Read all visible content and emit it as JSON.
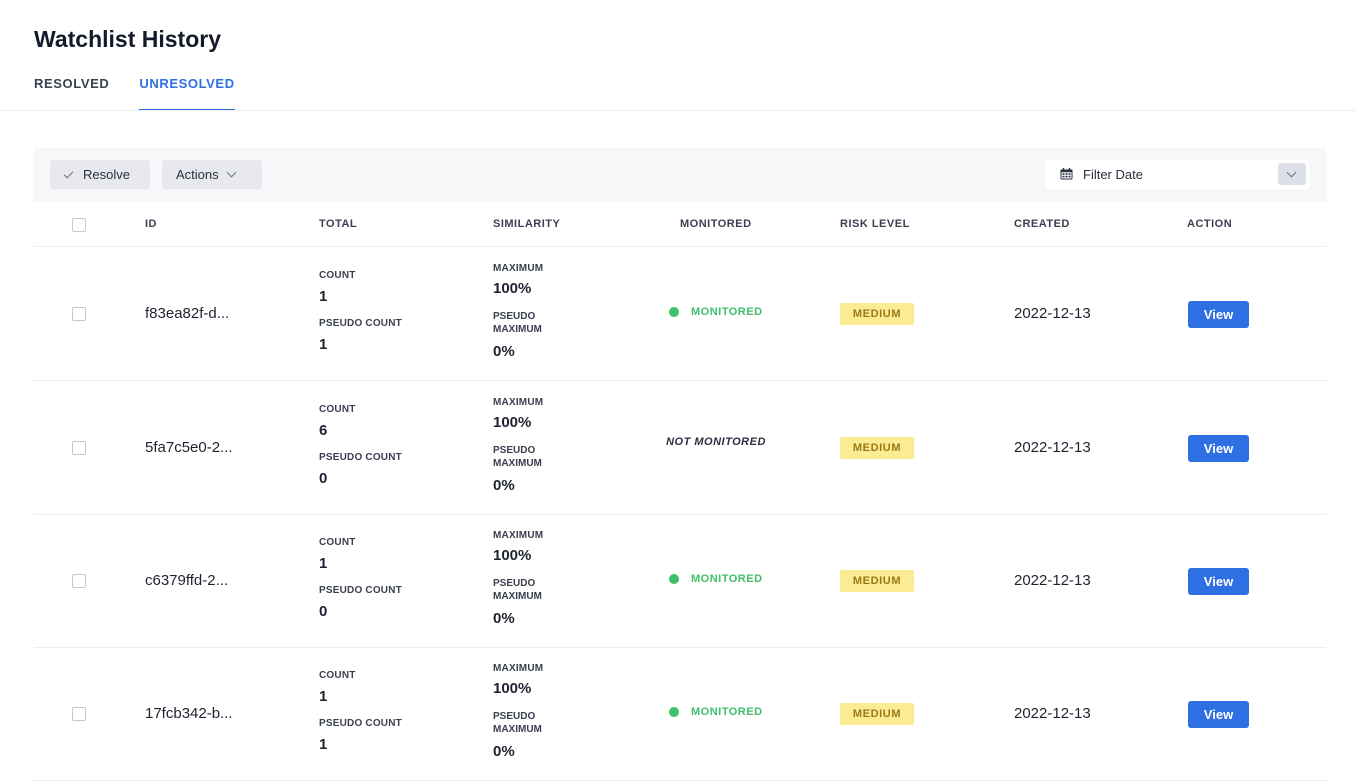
{
  "page": {
    "title": "Watchlist History"
  },
  "tabs": [
    {
      "label": "RESOLVED",
      "active": false
    },
    {
      "label": "UNRESOLVED",
      "active": true
    }
  ],
  "toolbar": {
    "resolve_label": "Resolve",
    "actions_label": "Actions",
    "filter_date_label": "Filter Date"
  },
  "table": {
    "columns": [
      "ID",
      "TOTAL",
      "SIMILARITY",
      "MONITORED",
      "RISK LEVEL",
      "CREATED",
      "ACTION"
    ],
    "labels": {
      "count": "COUNT",
      "pseudo_count": "PSEUDO COUNT",
      "maximum": "MAXIMUM",
      "pseudo_maximum": "PSEUDO MAXIMUM"
    },
    "rows": [
      {
        "id": "f83ea82f-d...",
        "count": "1",
        "pseudo_count": "1",
        "maximum": "100%",
        "pseudo_maximum": "0%",
        "monitored": true,
        "monitored_text": "MONITORED",
        "risk": "MEDIUM",
        "created": "2022-12-13",
        "action": "View"
      },
      {
        "id": "5fa7c5e0-2...",
        "count": "6",
        "pseudo_count": "0",
        "maximum": "100%",
        "pseudo_maximum": "0%",
        "monitored": false,
        "monitored_text": "NOT MONITORED",
        "risk": "MEDIUM",
        "created": "2022-12-13",
        "action": "View"
      },
      {
        "id": "c6379ffd-2...",
        "count": "1",
        "pseudo_count": "0",
        "maximum": "100%",
        "pseudo_maximum": "0%",
        "monitored": true,
        "monitored_text": "MONITORED",
        "risk": "MEDIUM",
        "created": "2022-12-13",
        "action": "View"
      },
      {
        "id": "17fcb342-b...",
        "count": "1",
        "pseudo_count": "1",
        "maximum": "100%",
        "pseudo_maximum": "0%",
        "monitored": true,
        "monitored_text": "MONITORED",
        "risk": "MEDIUM",
        "created": "2022-12-13",
        "action": "View"
      }
    ]
  },
  "colors": {
    "accent": "#2f6fe4",
    "monitored": "#3fbf6a",
    "risk_medium_bg": "#fbeb92",
    "risk_medium_text": "#9a7a16"
  }
}
